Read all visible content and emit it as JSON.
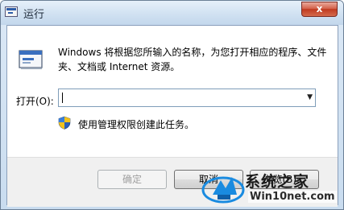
{
  "window": {
    "title": "运行",
    "close_glyph": "x",
    "app_icon": "run-dialog-icon",
    "chrome_color": "#c9dcef"
  },
  "dialog": {
    "description": "Windows 将根据您所输入的名称，为您打开相应的程序、文件夹、文档或 Internet 资源。",
    "open_label": "打开(O):",
    "open_value": "",
    "run_icon": "run-icon",
    "uac_note": "使用管理权限创建此任务。",
    "uac_icon": "uac-shield-icon"
  },
  "buttons": {
    "ok": "确定",
    "cancel": "取消",
    "browse": "浏览(B)..."
  },
  "watermark": {
    "name": "系统之家",
    "url": "Win10net.com",
    "color": "#1a8be0"
  }
}
